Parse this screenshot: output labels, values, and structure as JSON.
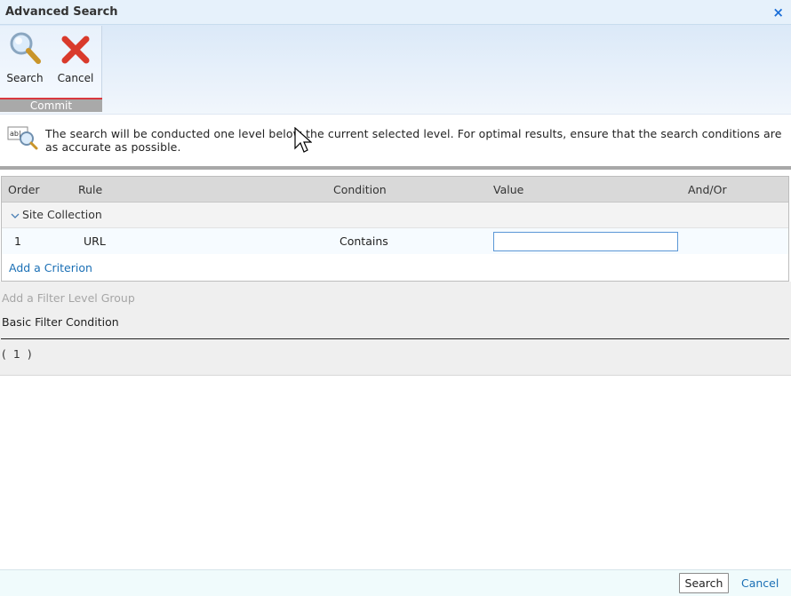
{
  "dialog": {
    "title": "Advanced Search",
    "close_label": "×"
  },
  "ribbon": {
    "group_label": "Commit",
    "buttons": [
      {
        "label": "Search",
        "icon": "magnifier-icon"
      },
      {
        "label": "Cancel",
        "icon": "red-x-icon"
      }
    ]
  },
  "info": {
    "text": "The search will be conducted one level below the current selected level. For optimal results, ensure that the search conditions are as accurate as possible."
  },
  "grid": {
    "headers": [
      "Order",
      "Rule",
      "Condition",
      "Value",
      "And/Or"
    ],
    "group_label": "Site Collection",
    "rows": [
      {
        "order": "1",
        "rule": "URL",
        "condition": "Contains",
        "value": "",
        "and_or": ""
      }
    ],
    "add_criterion": "Add a Criterion"
  },
  "filter": {
    "add_group": "Add a Filter Level Group",
    "basic_condition": "Basic Filter Condition",
    "expression": "( 1 )"
  },
  "footer": {
    "search_label": "Search",
    "cancel_label": "Cancel"
  },
  "colors": {
    "accent_blue": "#1a6fb5",
    "commit_red": "#d9393f"
  }
}
